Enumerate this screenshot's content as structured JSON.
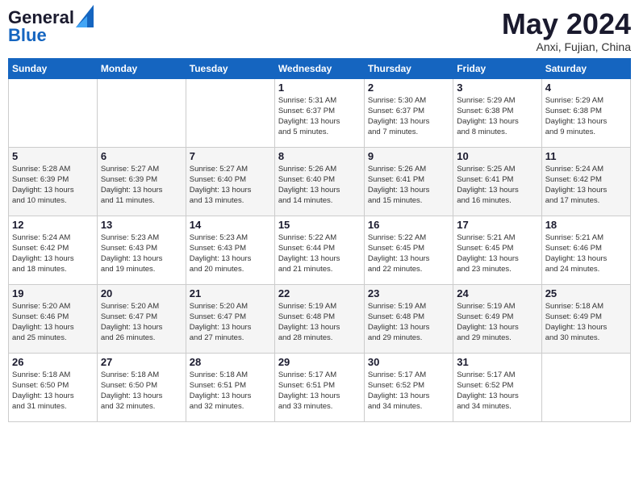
{
  "header": {
    "logo_general": "General",
    "logo_blue": "Blue",
    "month_year": "May 2024",
    "location": "Anxi, Fujian, China"
  },
  "days_of_week": [
    "Sunday",
    "Monday",
    "Tuesday",
    "Wednesday",
    "Thursday",
    "Friday",
    "Saturday"
  ],
  "weeks": [
    [
      {
        "day": "",
        "info": ""
      },
      {
        "day": "",
        "info": ""
      },
      {
        "day": "",
        "info": ""
      },
      {
        "day": "1",
        "info": "Sunrise: 5:31 AM\nSunset: 6:37 PM\nDaylight: 13 hours\nand 5 minutes."
      },
      {
        "day": "2",
        "info": "Sunrise: 5:30 AM\nSunset: 6:37 PM\nDaylight: 13 hours\nand 7 minutes."
      },
      {
        "day": "3",
        "info": "Sunrise: 5:29 AM\nSunset: 6:38 PM\nDaylight: 13 hours\nand 8 minutes."
      },
      {
        "day": "4",
        "info": "Sunrise: 5:29 AM\nSunset: 6:38 PM\nDaylight: 13 hours\nand 9 minutes."
      }
    ],
    [
      {
        "day": "5",
        "info": "Sunrise: 5:28 AM\nSunset: 6:39 PM\nDaylight: 13 hours\nand 10 minutes."
      },
      {
        "day": "6",
        "info": "Sunrise: 5:27 AM\nSunset: 6:39 PM\nDaylight: 13 hours\nand 11 minutes."
      },
      {
        "day": "7",
        "info": "Sunrise: 5:27 AM\nSunset: 6:40 PM\nDaylight: 13 hours\nand 13 minutes."
      },
      {
        "day": "8",
        "info": "Sunrise: 5:26 AM\nSunset: 6:40 PM\nDaylight: 13 hours\nand 14 minutes."
      },
      {
        "day": "9",
        "info": "Sunrise: 5:26 AM\nSunset: 6:41 PM\nDaylight: 13 hours\nand 15 minutes."
      },
      {
        "day": "10",
        "info": "Sunrise: 5:25 AM\nSunset: 6:41 PM\nDaylight: 13 hours\nand 16 minutes."
      },
      {
        "day": "11",
        "info": "Sunrise: 5:24 AM\nSunset: 6:42 PM\nDaylight: 13 hours\nand 17 minutes."
      }
    ],
    [
      {
        "day": "12",
        "info": "Sunrise: 5:24 AM\nSunset: 6:42 PM\nDaylight: 13 hours\nand 18 minutes."
      },
      {
        "day": "13",
        "info": "Sunrise: 5:23 AM\nSunset: 6:43 PM\nDaylight: 13 hours\nand 19 minutes."
      },
      {
        "day": "14",
        "info": "Sunrise: 5:23 AM\nSunset: 6:43 PM\nDaylight: 13 hours\nand 20 minutes."
      },
      {
        "day": "15",
        "info": "Sunrise: 5:22 AM\nSunset: 6:44 PM\nDaylight: 13 hours\nand 21 minutes."
      },
      {
        "day": "16",
        "info": "Sunrise: 5:22 AM\nSunset: 6:45 PM\nDaylight: 13 hours\nand 22 minutes."
      },
      {
        "day": "17",
        "info": "Sunrise: 5:21 AM\nSunset: 6:45 PM\nDaylight: 13 hours\nand 23 minutes."
      },
      {
        "day": "18",
        "info": "Sunrise: 5:21 AM\nSunset: 6:46 PM\nDaylight: 13 hours\nand 24 minutes."
      }
    ],
    [
      {
        "day": "19",
        "info": "Sunrise: 5:20 AM\nSunset: 6:46 PM\nDaylight: 13 hours\nand 25 minutes."
      },
      {
        "day": "20",
        "info": "Sunrise: 5:20 AM\nSunset: 6:47 PM\nDaylight: 13 hours\nand 26 minutes."
      },
      {
        "day": "21",
        "info": "Sunrise: 5:20 AM\nSunset: 6:47 PM\nDaylight: 13 hours\nand 27 minutes."
      },
      {
        "day": "22",
        "info": "Sunrise: 5:19 AM\nSunset: 6:48 PM\nDaylight: 13 hours\nand 28 minutes."
      },
      {
        "day": "23",
        "info": "Sunrise: 5:19 AM\nSunset: 6:48 PM\nDaylight: 13 hours\nand 29 minutes."
      },
      {
        "day": "24",
        "info": "Sunrise: 5:19 AM\nSunset: 6:49 PM\nDaylight: 13 hours\nand 29 minutes."
      },
      {
        "day": "25",
        "info": "Sunrise: 5:18 AM\nSunset: 6:49 PM\nDaylight: 13 hours\nand 30 minutes."
      }
    ],
    [
      {
        "day": "26",
        "info": "Sunrise: 5:18 AM\nSunset: 6:50 PM\nDaylight: 13 hours\nand 31 minutes."
      },
      {
        "day": "27",
        "info": "Sunrise: 5:18 AM\nSunset: 6:50 PM\nDaylight: 13 hours\nand 32 minutes."
      },
      {
        "day": "28",
        "info": "Sunrise: 5:18 AM\nSunset: 6:51 PM\nDaylight: 13 hours\nand 32 minutes."
      },
      {
        "day": "29",
        "info": "Sunrise: 5:17 AM\nSunset: 6:51 PM\nDaylight: 13 hours\nand 33 minutes."
      },
      {
        "day": "30",
        "info": "Sunrise: 5:17 AM\nSunset: 6:52 PM\nDaylight: 13 hours\nand 34 minutes."
      },
      {
        "day": "31",
        "info": "Sunrise: 5:17 AM\nSunset: 6:52 PM\nDaylight: 13 hours\nand 34 minutes."
      },
      {
        "day": "",
        "info": ""
      }
    ]
  ]
}
